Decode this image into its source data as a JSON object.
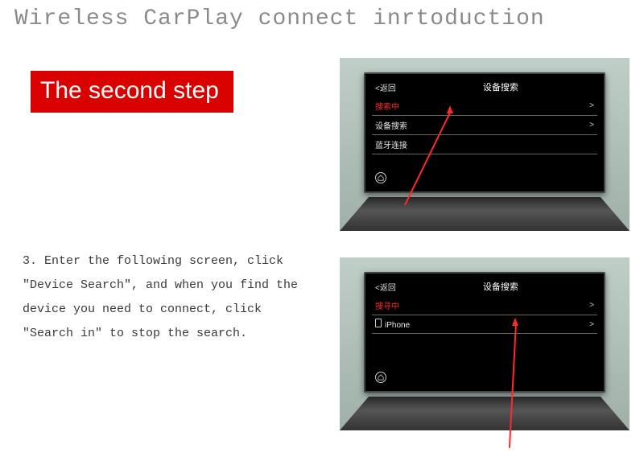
{
  "title": "Wireless CarPlay connect inrtoduction",
  "step_badge": "The second step",
  "instruction": "3. Enter the following screen, click \"Device Search\", and when you find the device you need to connect, click \"Search in\" to stop the search.",
  "screen1": {
    "back": "<返回",
    "title": "设备搜索",
    "row1": "搜索中",
    "row2": "设备搜索",
    "row3": "蓝牙连接"
  },
  "screen2": {
    "back": "<返回",
    "title": "设备搜索",
    "row1": "搜寻中",
    "row2": "iPhone"
  }
}
